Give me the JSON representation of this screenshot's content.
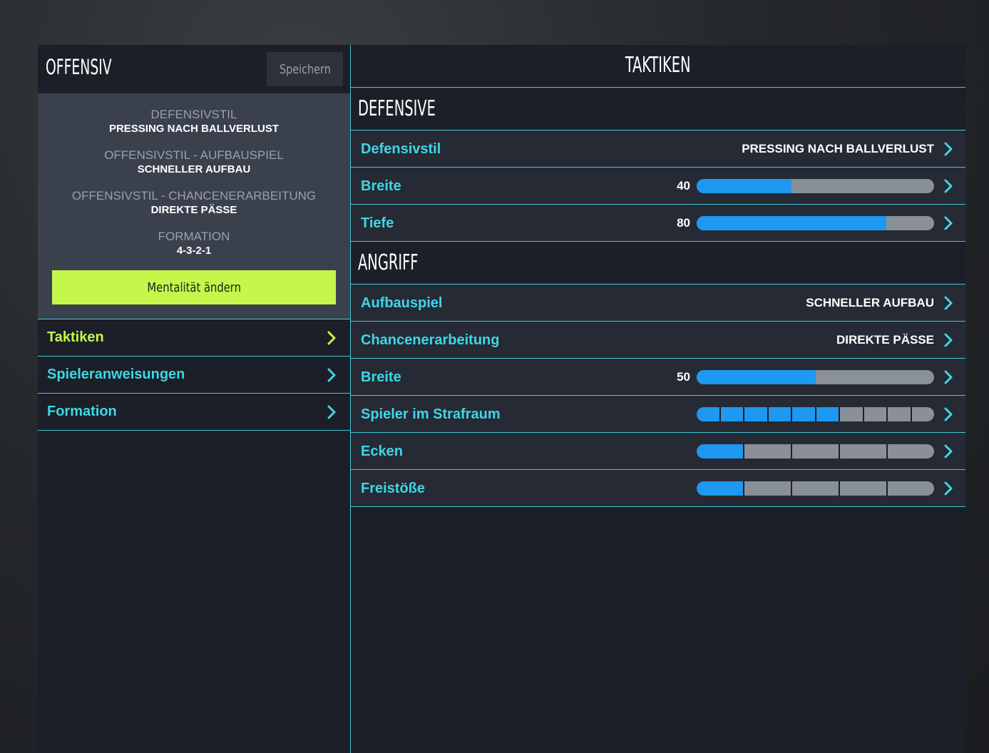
{
  "left": {
    "mentality_title": "OFFENSIV",
    "save_label": "Speichern",
    "summary": [
      {
        "label": "DEFENSIVSTIL",
        "value": "PRESSING NACH BALLVERLUST"
      },
      {
        "label": "OFFENSIVSTIL - AUFBAUSPIEL",
        "value": "SCHNELLER AUFBAU"
      },
      {
        "label": "OFFENSIVSTIL - CHANCENERARBEITUNG",
        "value": "DIREKTE PÄSSE"
      },
      {
        "label": "FORMATION",
        "value": "4-3-2-1"
      }
    ],
    "change_mentality_label": "Mentalität ändern",
    "nav": [
      {
        "label": "Taktiken",
        "active": true
      },
      {
        "label": "Spieleranweisungen",
        "active": false
      },
      {
        "label": "Formation",
        "active": false
      }
    ]
  },
  "right": {
    "title": "TAKTIKEN",
    "defensive": {
      "heading": "DEFENSIVE",
      "rows": [
        {
          "label": "Defensivstil",
          "value": "PRESSING NACH BALLVERLUST"
        },
        {
          "label": "Breite",
          "number": "40",
          "fill_percent": 40
        },
        {
          "label": "Tiefe",
          "number": "80",
          "fill_percent": 80
        }
      ]
    },
    "attack": {
      "heading": "ANGRIFF",
      "rows": [
        {
          "label": "Aufbauspiel",
          "value": "SCHNELLER AUFBAU"
        },
        {
          "label": "Chancenerarbeitung",
          "value": "DIREKTE PÄSSE"
        },
        {
          "label": "Breite",
          "number": "50",
          "fill_percent": 50
        },
        {
          "label": "Spieler im Strafraum",
          "segments_total": 10,
          "segments_on": 6
        },
        {
          "label": "Ecken",
          "segments_total": 5,
          "segments_on": 1
        },
        {
          "label": "Freistöße",
          "segments_total": 5,
          "segments_on": 1
        }
      ]
    }
  },
  "colors": {
    "accent_cyan": "#3fd6e6",
    "accent_lime": "#c4f74a",
    "bar_blue": "#1e98f0",
    "bar_gray": "#8a9099"
  },
  "icons": {
    "nav_chevron": "chevron-right-icon",
    "row_chevron": "chevron-right-icon"
  }
}
